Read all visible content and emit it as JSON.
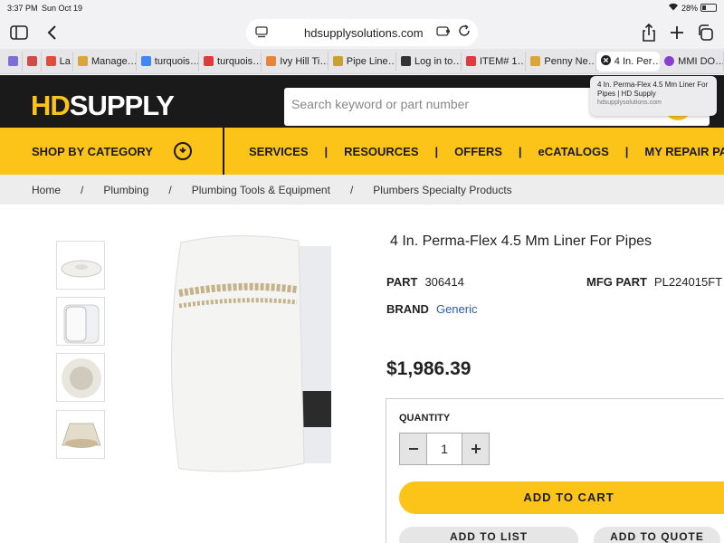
{
  "status": {
    "time": "3:37 PM",
    "date": "Sun Oct 19",
    "battery": "28%"
  },
  "browser": {
    "url": "hdsupplysolutions.com"
  },
  "tabs": [
    {
      "label": "",
      "color": "#7b6fd6"
    },
    {
      "label": "",
      "color": "#d24b4b"
    },
    {
      "label": "La",
      "color": "#e24c3a"
    },
    {
      "label": "Manage…",
      "color": "#d9a63a"
    },
    {
      "label": "turquois…",
      "color": "#4285f4"
    },
    {
      "label": "turquois…",
      "color": "#e0393e"
    },
    {
      "label": "Ivy Hill Ti…",
      "color": "#e8843a"
    },
    {
      "label": "Pipe Line…",
      "color": "#c8a030"
    },
    {
      "label": "Log in to…",
      "color": "#333333"
    },
    {
      "label": "ITEM# 1…",
      "color": "#e0393e"
    },
    {
      "label": "Penny Ne…",
      "color": "#d9a63a"
    },
    {
      "label": "4 In. Per…",
      "color": "#222222"
    },
    {
      "label": "MMI DO…",
      "color": "#8a3fd0"
    }
  ],
  "tooltip": {
    "title": "4 In. Perma-Flex 4.5 Mm Liner For Pipes | HD Supply",
    "url": "hdsupplysolutions.com"
  },
  "header": {
    "logo_hd": "HD",
    "logo_supply": "SUPPLY",
    "search_placeholder": "Search keyword or part number"
  },
  "nav": {
    "shop_by_category": "SHOP BY CATEGORY",
    "links": [
      "SERVICES",
      "RESOURCES",
      "OFFERS",
      "eCATALOGS",
      "MY REPAIR PA"
    ]
  },
  "breadcrumb": [
    "Home",
    "Plumbing",
    "Plumbing Tools & Equipment",
    "Plumbers Specialty Products"
  ],
  "product": {
    "title": "4 In. Perma-Flex 4.5 Mm Liner For Pipes",
    "part_label": "PART",
    "part": "306414",
    "mfg_label": "MFG PART",
    "mfg_part": "PL224015FT",
    "brand_label": "BRAND",
    "brand": "Generic",
    "price": "$1,986.39",
    "quantity_label": "QUANTITY",
    "quantity": "1",
    "add_to_cart": "ADD TO CART",
    "add_to_list": "ADD TO LIST",
    "add_to_quote": "ADD TO QUOTE"
  },
  "colors": {
    "brand_yellow": "#fcc419",
    "header_black": "#1a1a1a",
    "link_blue": "#2a5db0"
  }
}
